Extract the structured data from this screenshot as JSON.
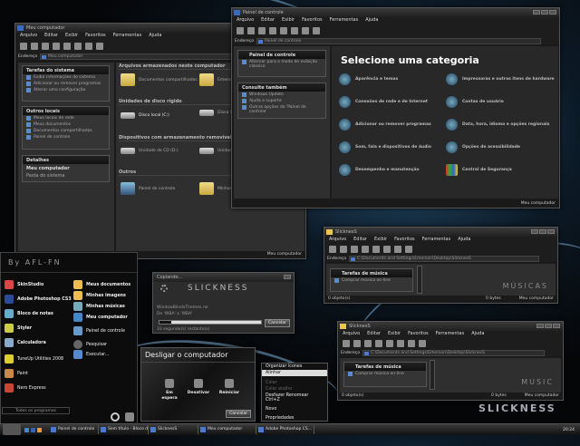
{
  "my_computer": {
    "title": "Meu computador",
    "menu": [
      "Arquivo",
      "Editar",
      "Exibir",
      "Favoritos",
      "Ferramentas",
      "Ajuda"
    ],
    "address_label": "Endereço",
    "address": "Meu computador",
    "panels": [
      {
        "title": "Tarefas do sistema",
        "items": [
          "Exibir informações do sistema",
          "Adicionar ou remover programas",
          "Alterar uma configuração"
        ]
      },
      {
        "title": "Outros locais",
        "items": [
          "Meus locais de rede",
          "Meus documentos",
          "Documentos compartilhados",
          "Painel de controle"
        ]
      },
      {
        "title": "Detalhes",
        "items": [
          "Meu computador",
          "Pasta do sistema"
        ]
      }
    ],
    "sections": [
      "Arquivos armazenados neste computador",
      "Unidades de disco rígido",
      "Dispositivos com armazenamento removível",
      "Outros"
    ],
    "items": [
      "Documentos compartilhados",
      "Emerson",
      "Disco local (C:)",
      "Disco local",
      "Unidade de CD (D:)",
      "Unidade",
      "Painel de controle",
      "Minhas Compart."
    ],
    "status": "Meu computador"
  },
  "control_panel": {
    "title": "Painel de controle",
    "menu": [
      "Arquivo",
      "Editar",
      "Exibir",
      "Favoritos",
      "Ferramentas",
      "Ajuda"
    ],
    "address_label": "Endereço",
    "address": "Painel de controle",
    "panels": [
      {
        "title": "Painel de controle",
        "items": [
          "Alternar para o modo de exibição clássico"
        ]
      },
      {
        "title": "Consulte também",
        "items": [
          "Windows Update",
          "Ajuda e suporte",
          "Outras opções do 'Painel de controle'"
        ]
      }
    ],
    "heading": "Selecione uma categoria",
    "categories": [
      "Aparência e temas",
      "Impressoras e outros itens de hardware",
      "Conexões de rede e de Internet",
      "Contas de usuário",
      "Adicionar ou remover programas",
      "Data, hora, idioma e opções regionais",
      "Som, fala e dispositivos de áudio",
      "Opções de acessibilidade",
      "Desempenho e manutenção",
      "Central de Segurança"
    ],
    "status": "Meu computador"
  },
  "start_menu": {
    "header": "By AFL-FN",
    "left": [
      "SkinStudio",
      "Adobe Photoshop CS3",
      "Bloco de notas",
      "Styler",
      "Calculadora",
      "TuneUp Utilities 2008",
      "Paint",
      "Nero Express"
    ],
    "right": [
      "Meus documentos",
      "Minhas imagens",
      "Minhas músicas",
      "Meu computador",
      "Painel de controle",
      "Pesquisar",
      "Executar..."
    ],
    "all_programs": "Todos os programas"
  },
  "copy_dialog": {
    "title": "Copiando...",
    "logo": "SLICKNESS",
    "file": "WindowBlindsThemes.rar",
    "from_to": "De 'WBA' a 'WBA'",
    "remaining": "33 segundo(s) restante(s)",
    "cancel": "Cancelar",
    "progress": 0.12
  },
  "shutdown": {
    "title": "Desligar o computador",
    "buttons": [
      "Em espera",
      "Desativar",
      "Reiniciar"
    ],
    "cancel": "Cancelar"
  },
  "context_menu": {
    "items": [
      "Organizar ícones",
      "Alinhar",
      "Colar",
      "Colar atalho",
      "Desfazer Renomear",
      "Novo",
      "Propriedades"
    ],
    "shortcut": "Ctrl+Z"
  },
  "slick1": {
    "title": "SlicknesS",
    "menu": [
      "Arquivo",
      "Editar",
      "Exibir",
      "Favoritos",
      "Ferramentas",
      "Ajuda"
    ],
    "address_label": "Endereço",
    "address": "C:\\Documents and Settings\\Emerson\\Desktop\\SlicknesS",
    "panel_title": "Tarefas de música",
    "panel_item": "Comprar música on-line",
    "watermark": "MÚSICAS",
    "status_left": "0 objeto(s)",
    "status_size": "0 bytes",
    "status_right": "Meu computador"
  },
  "slick2": {
    "title": "SlicknesS",
    "menu": [
      "Arquivo",
      "Editar",
      "Exibir",
      "Favoritos",
      "Ferramentas",
      "Ajuda"
    ],
    "address_label": "Endereço",
    "address": "C:\\Documents and Settings\\Emerson\\Desktop\\SlicknesS",
    "panel_title": "Tarefas de música",
    "panel_item": "Comprar música on-line",
    "watermark": "MUSIC",
    "status_left": "0 objeto(s)",
    "status_size": "0 bytes",
    "status_right": "Meu computador"
  },
  "desktop_logo": "SLICKNESS",
  "taskbar": {
    "buttons": [
      "Painel de controle",
      "Sem título - Bloco de ...",
      "SlicknesS",
      "Meu computador",
      "Adobe Photoshop CS..."
    ],
    "clock": "20:24"
  }
}
